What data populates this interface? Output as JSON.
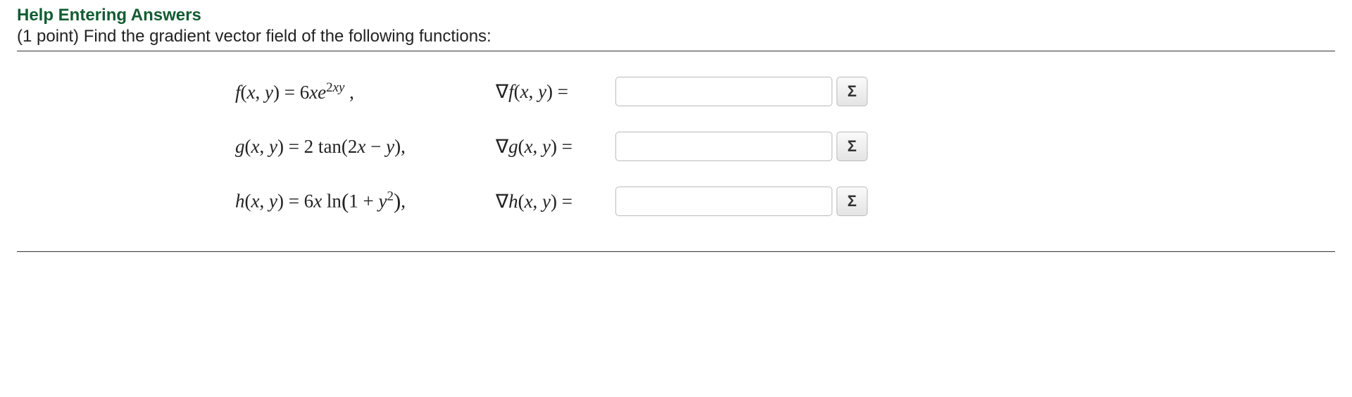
{
  "header": {
    "help_link": "Help Entering Answers",
    "points_prefix": "(1 point) ",
    "prompt": "Find the gradient vector field of the following functions:"
  },
  "rows": [
    {
      "func_html": "<span class='it'>f</span><span class='upright'>(</span><span class='it'>x</span><span class='upright'>, </span><span class='it'>y</span><span class='upright'>) = 6</span><span class='it'>xe</span><sup><span class='upright'>2</span>xy</sup><span class='upright'> ,</span>",
      "grad_html": "<span class='nabla'>∇</span><span class='it'>f</span><span class='upright'>(</span><span class='it'>x</span><span class='upright'>, </span><span class='it'>y</span><span class='upright'>) =</span>",
      "value": "",
      "placeholder": ""
    },
    {
      "func_html": "<span class='it'>g</span><span class='upright'>(</span><span class='it'>x</span><span class='upright'>, </span><span class='it'>y</span><span class='upright'>) = 2 tan(2</span><span class='it'>x</span><span class='upright'> − </span><span class='it'>y</span><span class='upright'>),</span>",
      "grad_html": "<span class='nabla'>∇</span><span class='it'>g</span><span class='upright'>(</span><span class='it'>x</span><span class='upright'>, </span><span class='it'>y</span><span class='upright'>) =</span>",
      "value": "",
      "placeholder": ""
    },
    {
      "func_html": "<span class='it'>h</span><span class='upright'>(</span><span class='it'>x</span><span class='upright'>, </span><span class='it'>y</span><span class='upright'>) = 6</span><span class='it'>x</span><span class='upright'> ln</span><span class='paren-big'>(</span><span class='upright'>1 + </span><span class='it'>y</span><sup><span class='upright'>2</span></sup><span class='paren-big'>)</span><span class='upright'>,</span>",
      "grad_html": "<span class='nabla'>∇</span><span class='it'>h</span><span class='upright'>(</span><span class='it'>x</span><span class='upright'>, </span><span class='it'>y</span><span class='upright'>) =</span>",
      "value": "",
      "placeholder": ""
    }
  ],
  "sigma_label": "Σ"
}
